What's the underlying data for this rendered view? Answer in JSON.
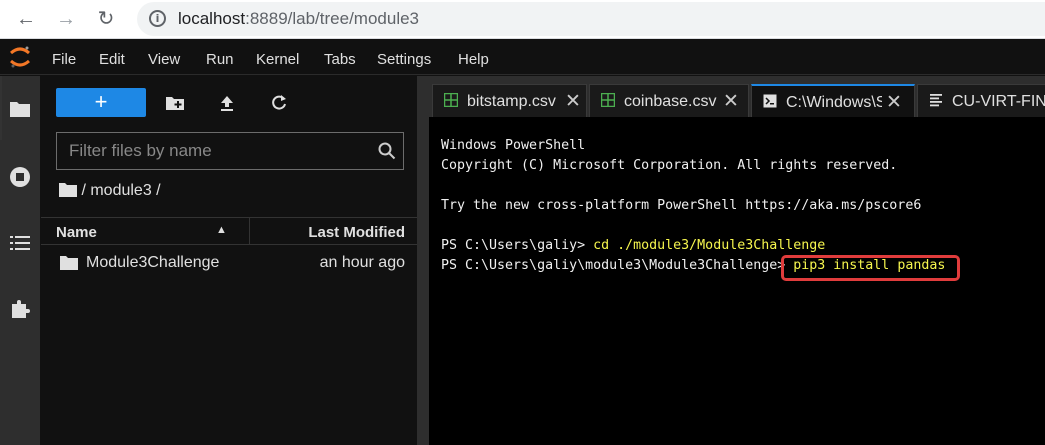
{
  "browser": {
    "url_host": "localhost",
    "url_rest": ":8889/lab/tree/module3"
  },
  "menu": {
    "items": [
      "File",
      "Edit",
      "View",
      "Run",
      "Kernel",
      "Tabs",
      "Settings",
      "Help"
    ]
  },
  "filebrowser": {
    "new_label": "+",
    "filter_placeholder": "Filter files by name",
    "breadcrumb": "/ module3 /",
    "col_name": "Name",
    "col_modified": "Last Modified",
    "rows": [
      {
        "name": "Module3Challenge",
        "modified": "an hour ago"
      }
    ]
  },
  "tabs": [
    {
      "label": "bitstamp.csv",
      "icon": "spreadsheet-icon"
    },
    {
      "label": "coinbase.csv",
      "icon": "spreadsheet-icon"
    },
    {
      "label": "C:\\Windows\\S",
      "icon": "terminal-icon"
    },
    {
      "label": "CU-VIRT-FIN-",
      "icon": "document-icon"
    }
  ],
  "terminal": {
    "lines": [
      "Windows PowerShell",
      "Copyright (C) Microsoft Corporation. All rights reserved.",
      "",
      "Try the new cross-platform PowerShell https://aka.ms/pscore6",
      ""
    ],
    "prompt1": "PS C:\\Users\\galiy> ",
    "cmd1": "cd ./module3/Module3Challenge",
    "prompt2": "PS C:\\Users\\galiy\\module3\\Module3Challenge> ",
    "cmd2": "pip3 install pandas"
  },
  "colors": {
    "accent": "#1e88e5",
    "highlight": "#e03c3c",
    "command": "#f6f64e"
  }
}
